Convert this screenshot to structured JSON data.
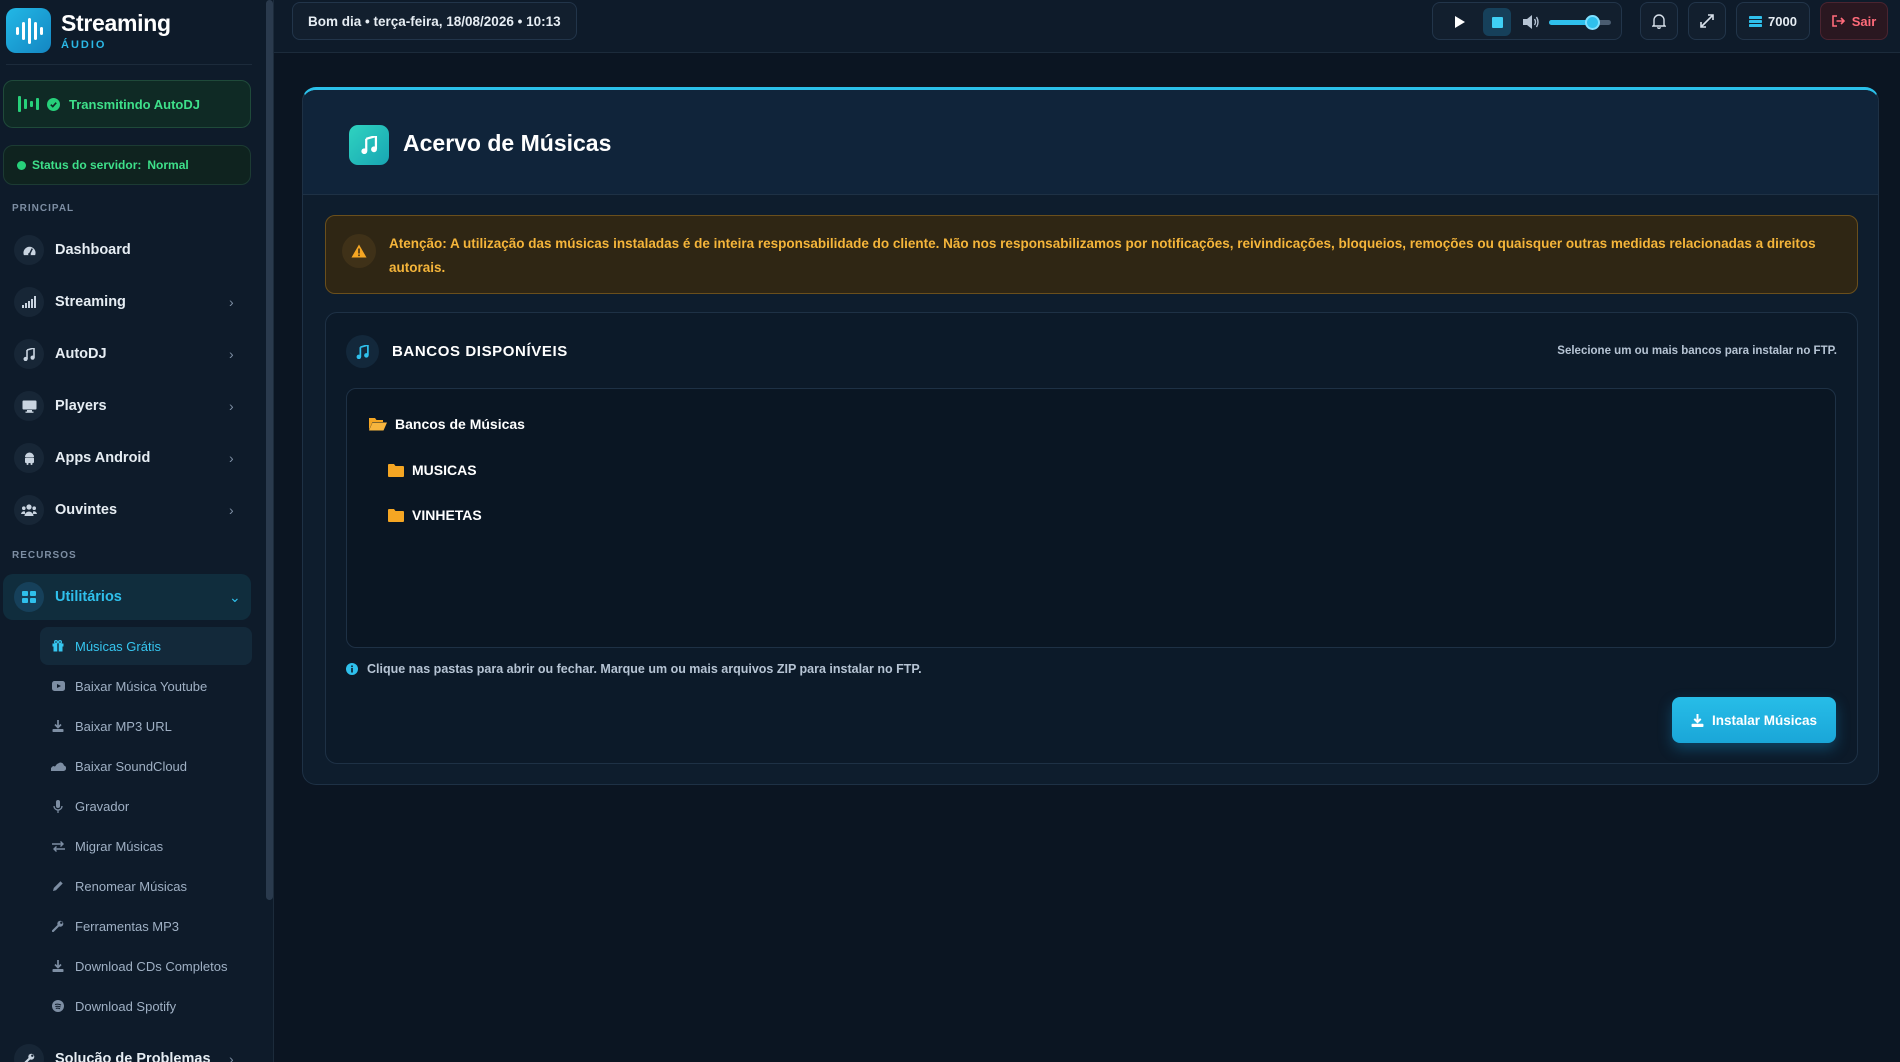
{
  "brand": {
    "name": "Streaming",
    "subtitle": "ÁUDIO"
  },
  "sidebar": {
    "live_status": "Transmitindo AutoDJ",
    "server_status": {
      "label": "Status do servidor:",
      "value": "Normal"
    },
    "sections": {
      "principal": "PRINCIPAL",
      "recursos": "RECURSOS"
    },
    "items": [
      {
        "label": "Dashboard",
        "icon": "gauge-icon"
      },
      {
        "label": "Streaming",
        "icon": "signal-icon"
      },
      {
        "label": "AutoDJ",
        "icon": "music-icon"
      },
      {
        "label": "Players",
        "icon": "monitor-icon"
      },
      {
        "label": "Apps Android",
        "icon": "android-icon"
      },
      {
        "label": "Ouvintes",
        "icon": "users-icon"
      }
    ],
    "utilities": {
      "label": "Utilitários",
      "icon": "grid-icon"
    },
    "sub_items": [
      {
        "label": "Músicas Grátis",
        "icon": "gift-icon",
        "active": true
      },
      {
        "label": "Baixar Música Youtube",
        "icon": "youtube-icon"
      },
      {
        "label": "Baixar MP3 URL",
        "icon": "download-icon"
      },
      {
        "label": "Baixar SoundCloud",
        "icon": "soundcloud-icon"
      },
      {
        "label": "Gravador",
        "icon": "microphone-icon"
      },
      {
        "label": "Migrar Músicas",
        "icon": "swap-icon"
      },
      {
        "label": "Renomear Músicas",
        "icon": "pencil-icon"
      },
      {
        "label": "Ferramentas MP3",
        "icon": "wrench-icon"
      },
      {
        "label": "Download CDs Completos",
        "icon": "download-icon"
      },
      {
        "label": "Download Spotify",
        "icon": "spotify-icon"
      }
    ],
    "troubleshoot": {
      "label": "Solução de Problemas",
      "icon": "wrench-icon"
    }
  },
  "topbar": {
    "greeting": "Bom dia • terça-feira, 18/08/2026 • 10:13",
    "volume_level": 0.7,
    "credits": "7000",
    "logout_label": "Sair"
  },
  "page": {
    "title": "Acervo de Músicas",
    "alert": "Atenção: A utilização das músicas instaladas é de inteira responsabilidade do cliente. Não nos responsabilizamos por notificações, reivindicações, bloqueios, remoções ou quaisquer outras medidas relacionadas a direitos autorais.",
    "banks": {
      "title": "BANCOS DISPONÍVEIS",
      "hint": "Selecione um ou mais bancos para instalar no FTP.",
      "root": "Bancos de Músicas",
      "folders": [
        "MUSICAS",
        "VINHETAS"
      ]
    },
    "info": "Clique nas pastas para abrir ou fechar. Marque um ou mais arquivos ZIP para instalar no FTP.",
    "install_button": "Instalar Músicas"
  },
  "colors": {
    "accent": "#2bc0ea",
    "success": "#27d07a",
    "warning": "#f5b53a",
    "danger": "#ff6b7a",
    "folder": "#f5a623"
  }
}
